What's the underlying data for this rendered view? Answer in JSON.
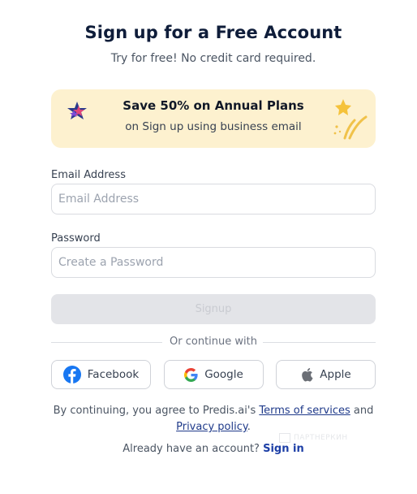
{
  "header": {
    "title": "Sign up for a Free Account",
    "subtitle": "Try for free! No credit card required."
  },
  "promo": {
    "title": "Save 50% on Annual Plans",
    "subtitle": "on Sign up using business email",
    "badge_icon": "star-badge-icon",
    "decor_icon": "celebration-burst-icon",
    "background": "#fdf1cf"
  },
  "form": {
    "email_label": "Email Address",
    "email_placeholder": "Email Address",
    "email_value": "",
    "password_label": "Password",
    "password_placeholder": "Create a Password",
    "password_value": "",
    "signup_label": "Signup"
  },
  "divider_text": "Or continue with",
  "social": {
    "facebook": "Facebook",
    "google": "Google",
    "apple": "Apple"
  },
  "terms": {
    "prefix": "By continuing, you agree to Predis.ai's ",
    "terms_link": "Terms of services",
    "middle": " and",
    "privacy_link": "Privacy policy",
    "suffix": "."
  },
  "signin": {
    "prompt": "Already have an account? ",
    "link": "Sign in"
  },
  "watermark": "ПАРТНЕРКИН",
  "colors": {
    "title": "#0f1d3a",
    "link": "#1d3fa6",
    "button_disabled": "#e3e4e8"
  }
}
